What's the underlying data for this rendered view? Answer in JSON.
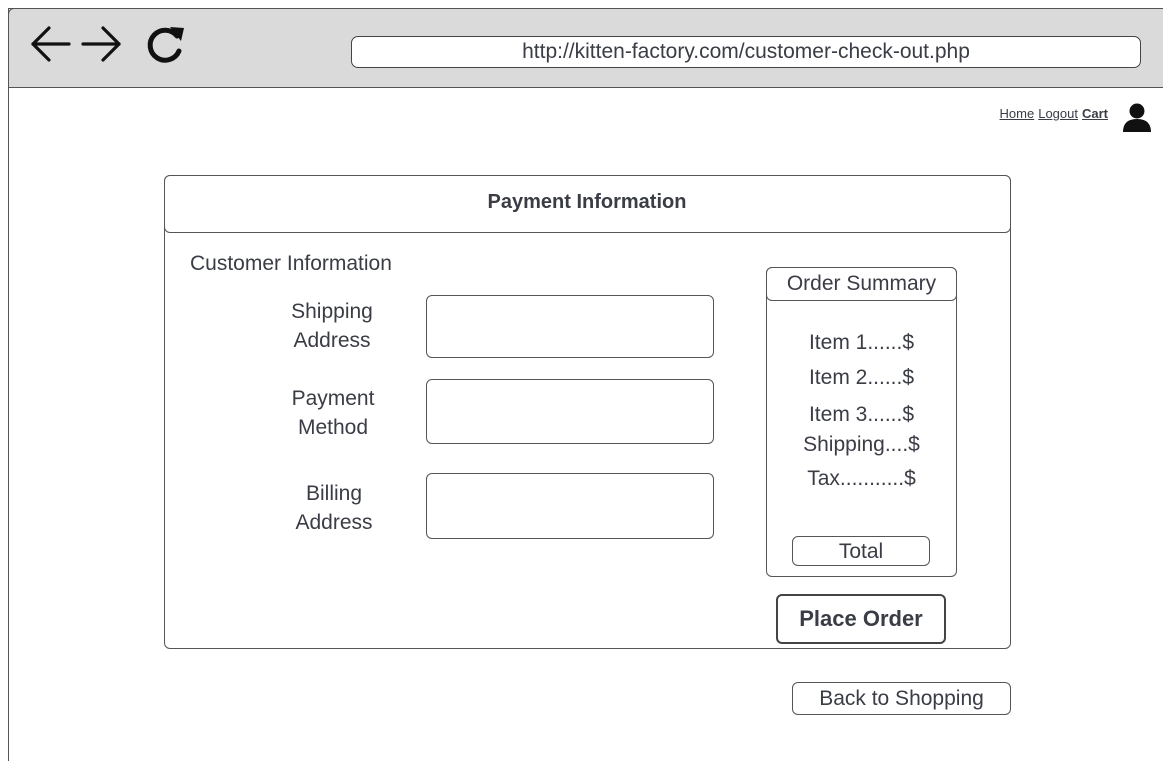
{
  "browser": {
    "url": "http://kitten-factory.com/customer-check-out.php",
    "back_icon": "arrow-left-icon",
    "forward_icon": "arrow-right-icon",
    "reload_icon": "reload-icon"
  },
  "top_nav": {
    "home": "Home",
    "logout": "Logout",
    "cart": "Cart",
    "user_icon": "user-icon"
  },
  "panel": {
    "title": "Payment Information",
    "section_title": "Customer Information",
    "fields": [
      {
        "line1": "Shipping",
        "line2": "Address",
        "value": ""
      },
      {
        "line1": "Payment",
        "line2": "Method",
        "value": ""
      },
      {
        "line1": "Billing",
        "line2": "Address",
        "value": ""
      }
    ]
  },
  "summary": {
    "title": "Order Summary",
    "lines": [
      "Item 1......$",
      "Item 2......$",
      "Item 3......$",
      "Shipping....$",
      "Tax...........$"
    ],
    "total": "Total"
  },
  "actions": {
    "place_order": "Place Order",
    "back_to_shopping": "Back to Shopping"
  }
}
